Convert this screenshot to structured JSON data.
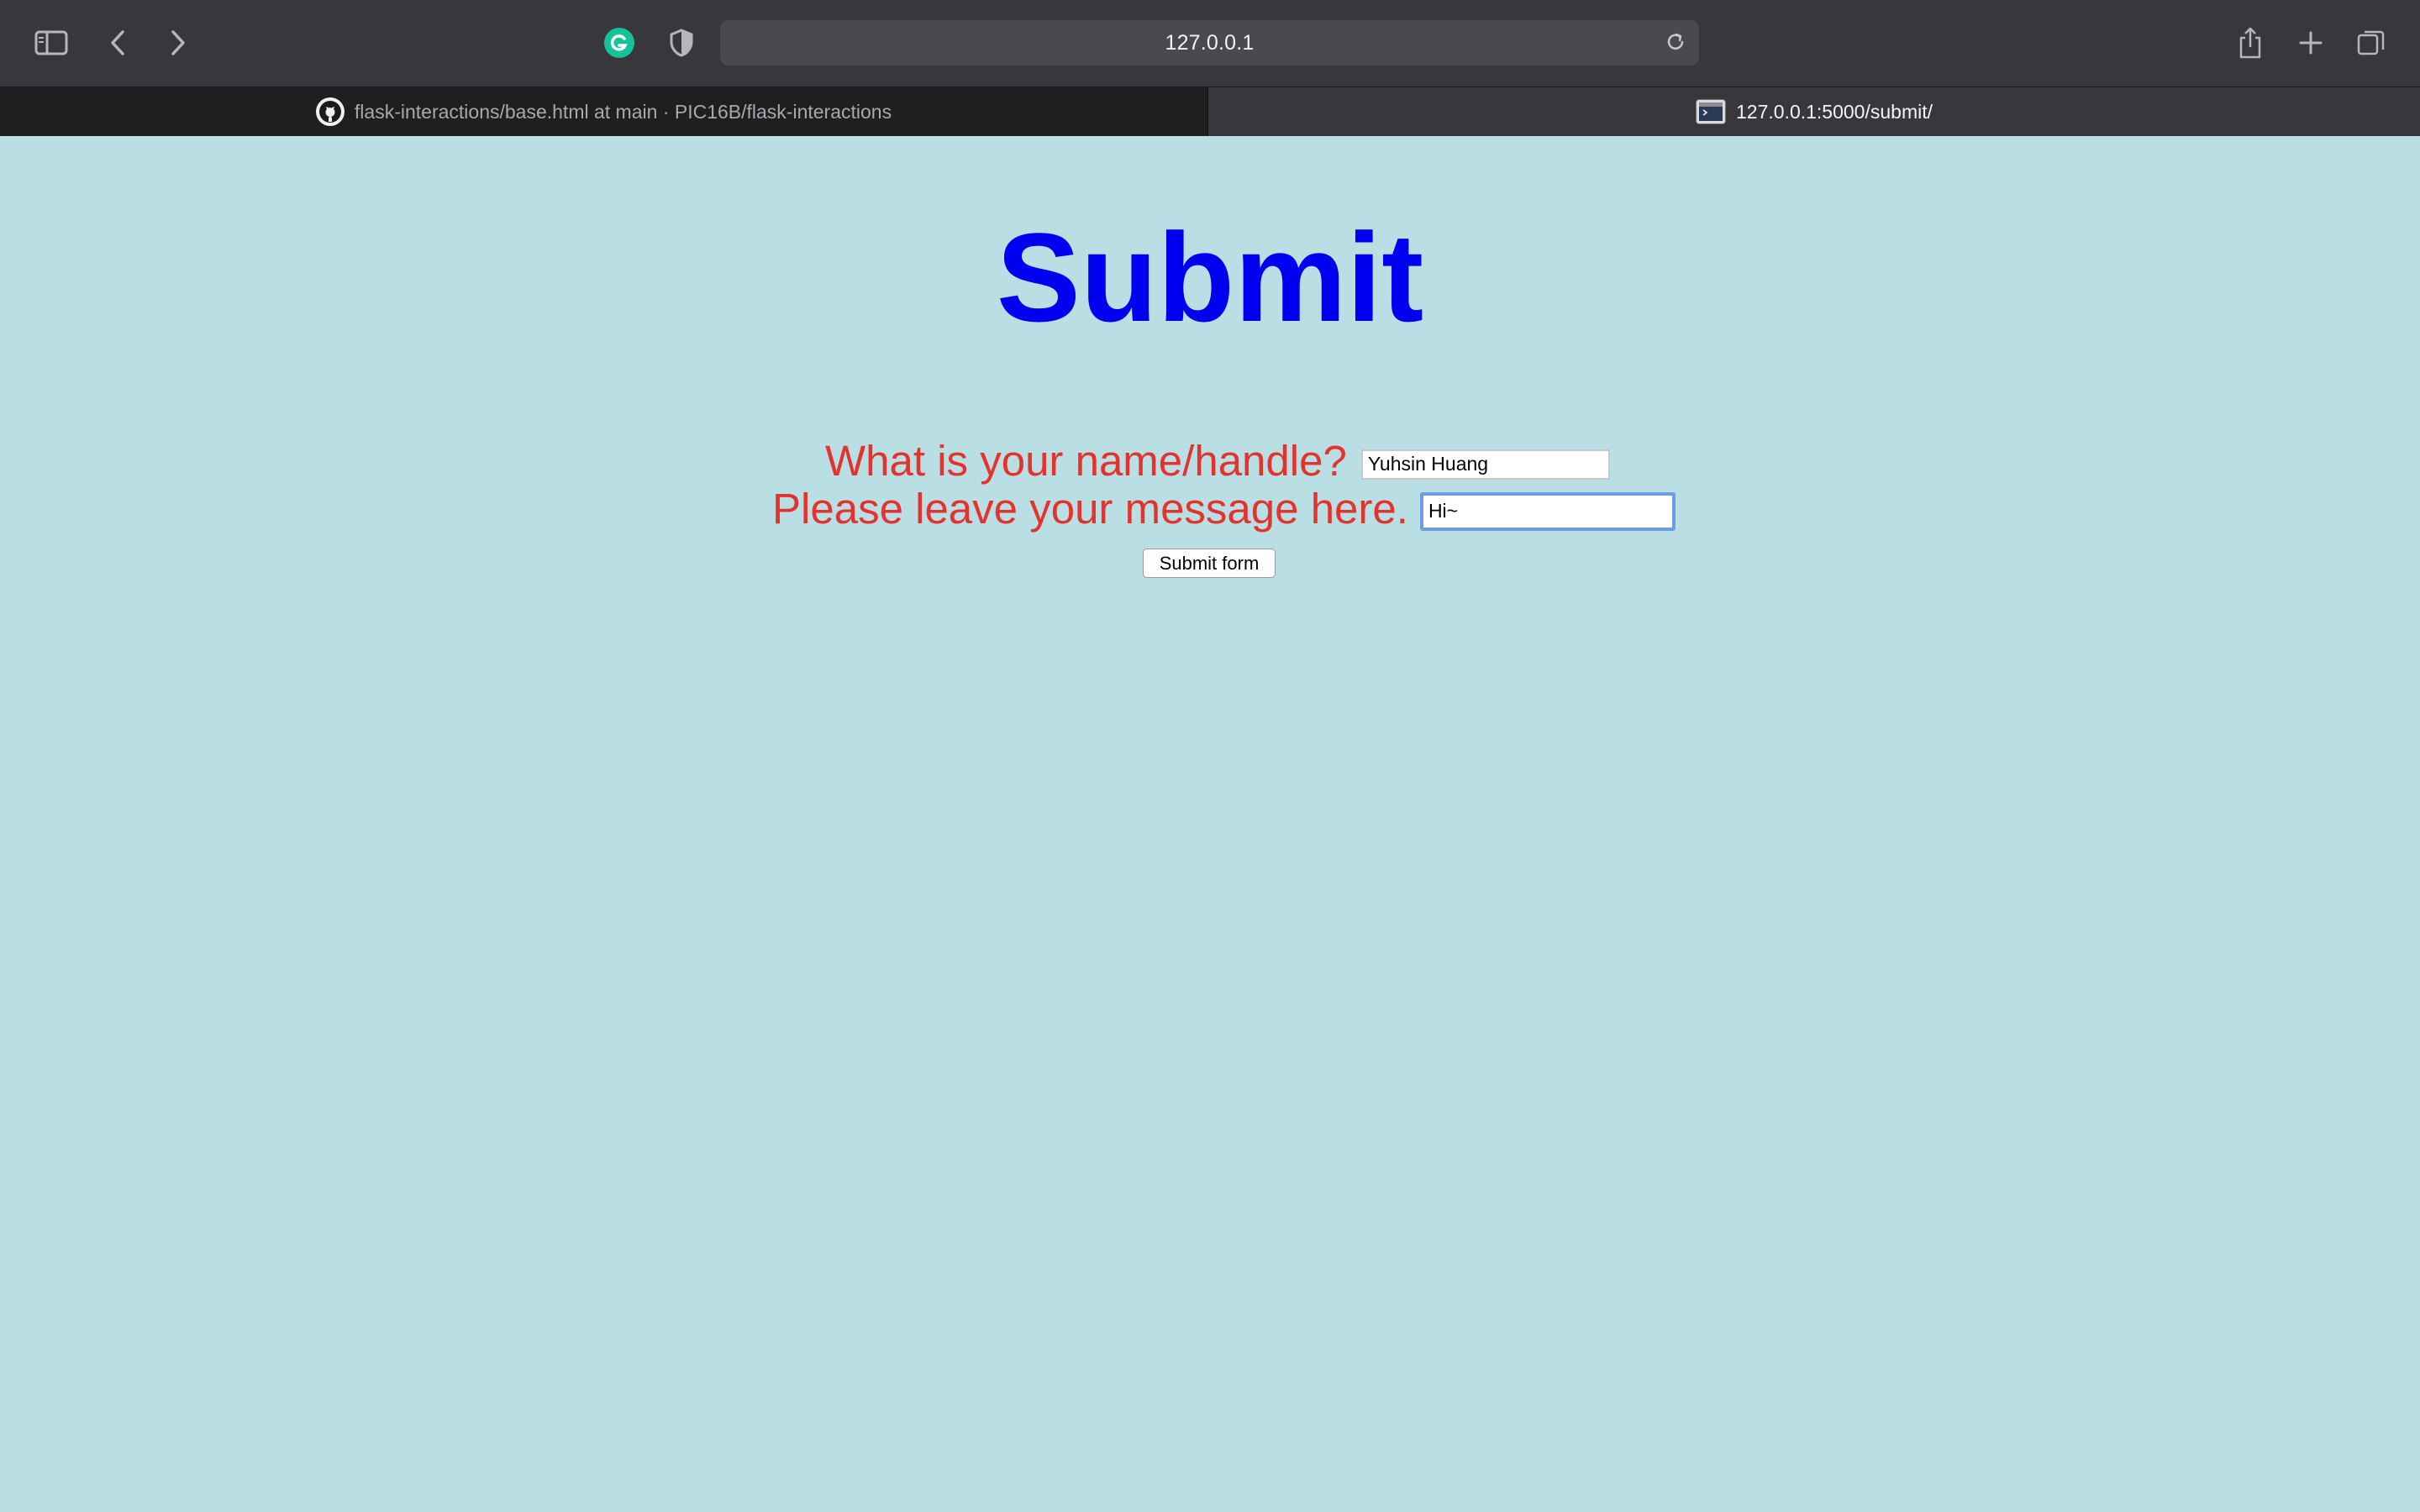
{
  "browser": {
    "address_bar": {
      "url": "127.0.0.1"
    },
    "tabs": [
      {
        "title": "flask-interactions/base.html at main · PIC16B/flask-interactions",
        "icon": "github-icon",
        "active": false
      },
      {
        "title": "127.0.0.1:5000/submit/",
        "icon": "terminal-icon",
        "active": true
      }
    ],
    "toolbar_icons": [
      "sidebar-icon",
      "back-icon",
      "forward-icon",
      "grammarly-icon",
      "privacy-shield-icon",
      "reload-icon",
      "share-icon",
      "new-tab-icon",
      "tab-overview-icon"
    ]
  },
  "page": {
    "heading": "Submit",
    "name_label": "What is your name/handle?",
    "name_value": "Yuhsin Huang",
    "message_label": "Please leave your message here.",
    "message_value": "Hi~",
    "submit_label": "Submit form",
    "colors": {
      "background": "#b9dfe5",
      "heading": "#0000f0",
      "label": "#e4322d"
    }
  }
}
